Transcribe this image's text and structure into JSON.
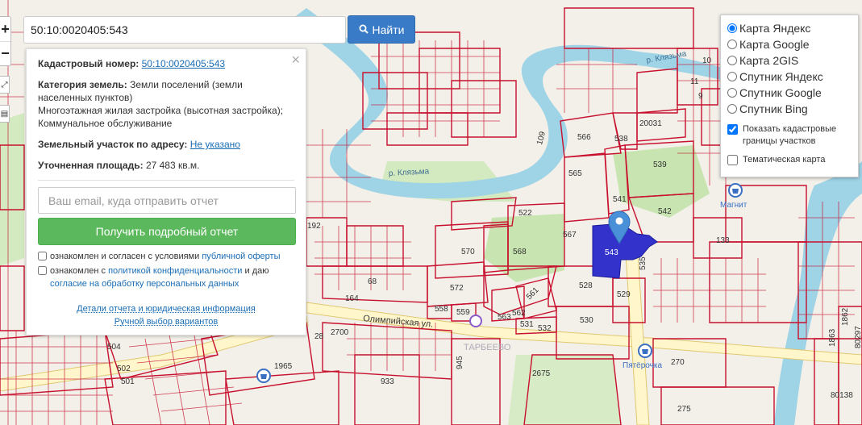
{
  "search": {
    "value": "50:10:0020405:543",
    "button_label": "Найти"
  },
  "info": {
    "cadastral_label": "Кадастровый номер:",
    "cadastral_value": "50:10:0020405:543",
    "category_label": "Категория земель:",
    "category_value": "Земли поселений (земли населенных пунктов)",
    "usage_line_1": "Многоэтажная жилая застройка (высотная застройка);",
    "usage_line_2": "Коммунальное обслуживание",
    "address_label": "Земельный участок по адресу:",
    "address_value": "Не указано",
    "area_label": "Уточненная площадь:",
    "area_value": "27 483 кв.м.",
    "email_placeholder": "Ваш email, куда отправить отчет",
    "report_button": "Получить подробный отчет",
    "agree1_prefix": "ознакомлен и согласен с условиями ",
    "agree1_link": "публичной оферты",
    "agree2_prefix": "ознакомлен с ",
    "agree2_link": "политикой конфиденциальности",
    "agree2_mid": " и даю ",
    "agree2_link2": "согласие на обработку персональных данных",
    "details_link": "Детали отчета и юридическая информация",
    "manual_link": "Ручной выбор вариантов"
  },
  "layers": {
    "options": [
      {
        "label": "Карта Яндекс",
        "checked": true
      },
      {
        "label": "Карта Google",
        "checked": false
      },
      {
        "label": "Карта 2GIS",
        "checked": false
      },
      {
        "label": "Спутник Яндекс",
        "checked": false
      },
      {
        "label": "Спутник Google",
        "checked": false
      },
      {
        "label": "Спутник Bing",
        "checked": false
      }
    ],
    "show_borders": "Показать кадастровые границы участков",
    "thematic": "Тематическая карта"
  },
  "map": {
    "zoom_in": "+",
    "zoom_out": "−",
    "river_label": "р. Клязьма",
    "street_label": "Олимпийская ул.",
    "district_label": "ТАРБЕЕВО",
    "shop_magnit": "Магнит",
    "shop_pyaterochka": "Пятёрочка",
    "colors": {
      "parcel_border": "#c8102e",
      "selected_parcel": "#3333cc",
      "river": "#9fd3e6",
      "green": "#c8e4b0",
      "road": "#fff6cc",
      "marker": "#4a90d9"
    },
    "parcel_numbers": [
      "566",
      "538",
      "20031",
      "539",
      "565",
      "541",
      "542",
      "567",
      "543",
      "535",
      "528",
      "529",
      "530",
      "570",
      "568",
      "522",
      "572",
      "558",
      "559",
      "563",
      "562",
      "561",
      "531",
      "532",
      "133",
      "11",
      "10",
      "9",
      "109",
      "192",
      "68",
      "164",
      "2700",
      "28",
      "933",
      "2675",
      "270",
      "1965",
      "1862",
      "1863",
      "80297",
      "80138",
      "504",
      "502",
      "501",
      "945",
      "275"
    ]
  }
}
